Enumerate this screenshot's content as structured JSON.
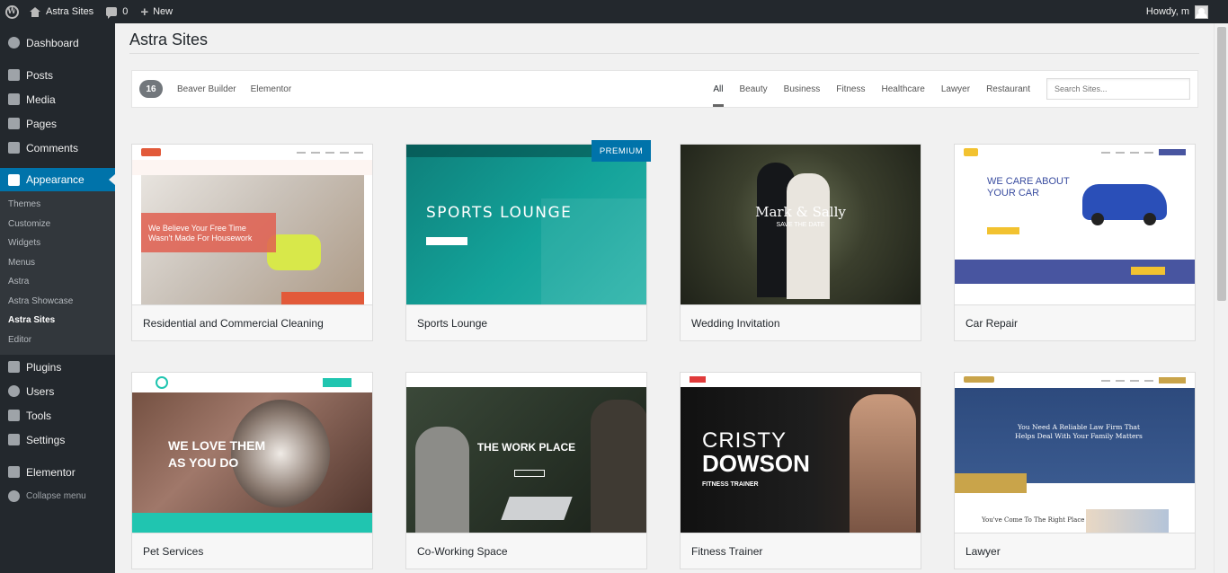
{
  "adminbar": {
    "site_name": "Astra Sites",
    "comments_count": "0",
    "new_label": "New",
    "howdy": "Howdy, m"
  },
  "sidebar": {
    "items": [
      {
        "label": "Dashboard",
        "icon": "dashboard-icon"
      },
      {
        "label": "Posts",
        "icon": "pin-icon"
      },
      {
        "label": "Media",
        "icon": "media-icon"
      },
      {
        "label": "Pages",
        "icon": "pages-icon"
      },
      {
        "label": "Comments",
        "icon": "comment-icon"
      },
      {
        "label": "Appearance",
        "icon": "brush-icon"
      },
      {
        "label": "Plugins",
        "icon": "plug-icon"
      },
      {
        "label": "Users",
        "icon": "user-icon"
      },
      {
        "label": "Tools",
        "icon": "wrench-icon"
      },
      {
        "label": "Settings",
        "icon": "settings-icon"
      },
      {
        "label": "Elementor",
        "icon": "elementor-icon"
      }
    ],
    "submenu": [
      "Themes",
      "Customize",
      "Widgets",
      "Menus",
      "Astra",
      "Astra Showcase",
      "Astra Sites",
      "Editor"
    ],
    "collapse_label": "Collapse menu"
  },
  "page": {
    "title": "Astra Sites"
  },
  "filters": {
    "count": "16",
    "page_builders": [
      "Beaver Builder",
      "Elementor"
    ],
    "categories": [
      "All",
      "Beauty",
      "Business",
      "Fitness",
      "Healthcare",
      "Lawyer",
      "Restaurant"
    ],
    "active_category": "All",
    "search_placeholder": "Search Sites..."
  },
  "premium_label": "PREMIUM",
  "sites": [
    {
      "name": "Residential and Commercial Cleaning",
      "hero": "We Believe Your Free Time Wasn't Made For Housework",
      "premium": false
    },
    {
      "name": "Sports Lounge",
      "hero": "SPORTS LOUNGE",
      "premium": true
    },
    {
      "name": "Wedding Invitation",
      "hero": "Mark & Sally",
      "sub": "SAVE THE DATE",
      "premium": false
    },
    {
      "name": "Car Repair",
      "hero": "WE CARE ABOUT YOUR CAR",
      "premium": false
    },
    {
      "name": "Pet Services",
      "hero": "WE LOVE THEM AS YOU DO",
      "premium": false
    },
    {
      "name": "Co-Working Space",
      "hero": "THE WORK PLACE",
      "premium": false
    },
    {
      "name": "Fitness Trainer",
      "hero": "CRISTY",
      "hero2": "DOWSON",
      "sub": "FITNESS TRAINER",
      "premium": false
    },
    {
      "name": "Lawyer",
      "hero": "You Need A Reliable Law Firm That Helps Deal With Your Family Matters",
      "sub": "You've Come To The Right Place",
      "premium": false
    }
  ],
  "colors": {
    "adminbar": "#23282d",
    "accent": "#0073aa",
    "premium": "#0073aa"
  }
}
